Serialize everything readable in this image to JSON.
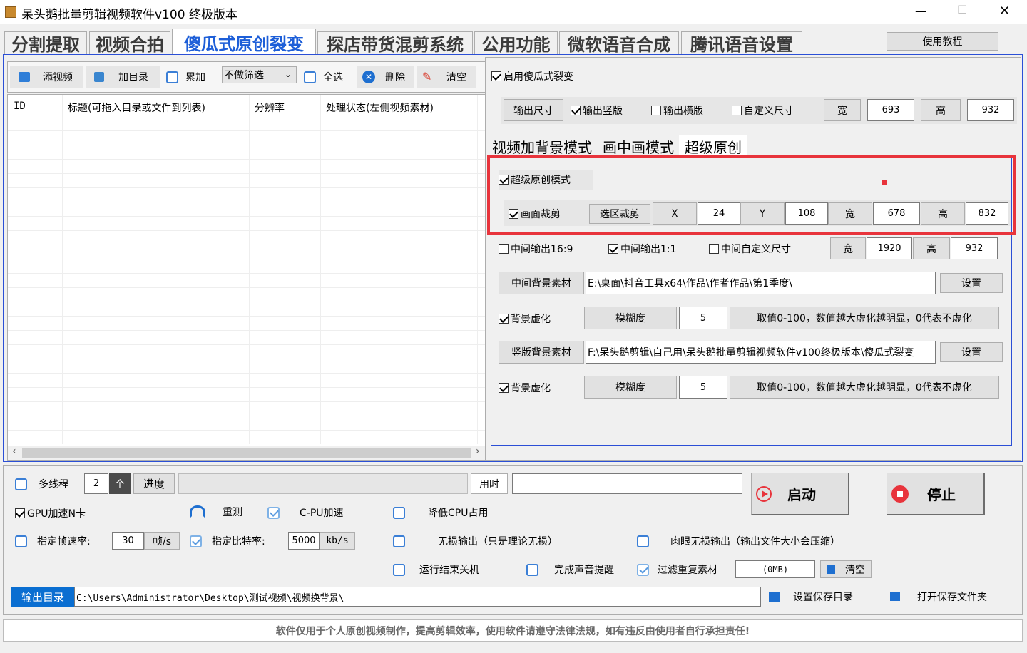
{
  "window": {
    "title": "呆头鹅批量剪辑视频软件v100 终极版本",
    "min_label": "—",
    "max_label": "☐",
    "close_label": "✕"
  },
  "tabs": [
    {
      "label": "分割提取"
    },
    {
      "label": "视频合拍"
    },
    {
      "label": "傻瓜式原创裂变"
    },
    {
      "label": "探店带货混剪系统"
    },
    {
      "label": "公用功能"
    },
    {
      "label": "微软语音合成"
    },
    {
      "label": "腾讯语音设置"
    }
  ],
  "help_button": "使用教程",
  "toolbar": {
    "add_video": "添视频",
    "add_dir": "加目录",
    "accumulate": "累加",
    "filter_value": "不做筛选",
    "select_all": "全选",
    "delete": "删除",
    "clear": "清空"
  },
  "table": {
    "headers": [
      "ID",
      "标题(可拖入目录或文件到列表)",
      "分辨率",
      "处理状态(左侧视频素材)"
    ]
  },
  "right": {
    "enable_label": "启用傻瓜式裂变",
    "output_size_btn": "输出尺寸",
    "output_portrait": "输出竖版",
    "output_landscape": "输出横版",
    "custom_size": "自定义尺寸",
    "w_label": "宽",
    "w_value": "693",
    "h_label": "高",
    "h_value": "932",
    "subtabs": [
      "视频加背景模式",
      "画中画模式",
      "超级原创"
    ],
    "super_mode": "超级原创模式",
    "crop_label": "画面裁剪",
    "select_crop": "选区裁剪",
    "x_label": "X",
    "x_value": "24",
    "y_label": "Y",
    "y_value": "108",
    "crop_w_label": "宽",
    "crop_w_value": "678",
    "crop_h_label": "高",
    "crop_h_value": "832",
    "mid_169": "中间输出16:9",
    "mid_11": "中间输出1:1",
    "mid_custom": "中间自定义尺寸",
    "mid_w_label": "宽",
    "mid_w_value": "1920",
    "mid_h_label": "高",
    "mid_h_value": "932",
    "mid_bg_btn": "中间背景素材",
    "mid_bg_path": "E:\\桌面\\抖音工具x64\\作品\\作者作品\\第1季度\\",
    "set_label": "设置",
    "bg_blur": "背景虚化",
    "blur_btn": "模糊度",
    "blur_value": "5",
    "blur_hint": "取值0-100，数值越大虚化越明显，0代表不虚化",
    "vert_bg_btn": "竖版背景素材",
    "vert_bg_path": "F:\\呆头鹅剪辑\\自己用\\呆头鹅批量剪辑视频软件v100终极版本\\傻瓜式裂变",
    "set_label2": "设置",
    "bg_blur2": "背景虚化",
    "blur_btn2": "模糊度",
    "blur_value2": "5",
    "blur_hint2": "取值0-100，数值越大虚化越明显，0代表不虚化"
  },
  "bottom": {
    "multithread": "多线程",
    "thread_count": "2",
    "thread_unit": "个",
    "progress_label": "进度",
    "time_label": "用时",
    "start": "启动",
    "stop": "停止",
    "gpu": "GPU加速N卡",
    "retest": "重测",
    "cpu_accel": "C-PU加速",
    "lower_cpu": "降低CPU占用",
    "fps_label": "指定帧速率:",
    "fps_value": "30",
    "fps_unit": "帧/s",
    "bitrate_label": "指定比特率:",
    "bitrate_value": "5000",
    "bitrate_unit": "kb/s",
    "lossless": "无损输出（只是理论无损）",
    "visual_lossless": "肉眼无损输出（输出文件大小会压缩）",
    "shutdown": "运行结束关机",
    "sound_notify": "完成声音提醒",
    "filter_dup": "过滤重复素材",
    "dup_size": "(0MB)",
    "dup_clear": "清空",
    "output_dir_label": "输出目录",
    "output_dir": "C:\\Users\\Administrator\\Desktop\\测试视频\\视频换背景\\",
    "set_save_dir": "设置保存目录",
    "open_save_dir": "打开保存文件夹"
  },
  "footer": "软件仅用于个人原创视频制作，提高剪辑效率，使用软件请遵守法律法规，如有违反由使用者自行承担责任!",
  "colors": {
    "active_tab": "#1e5fd8",
    "highlight_red": "#e8343c",
    "panel_border": "#2b4fd6",
    "output_dir_bg": "#0a6ed1"
  }
}
